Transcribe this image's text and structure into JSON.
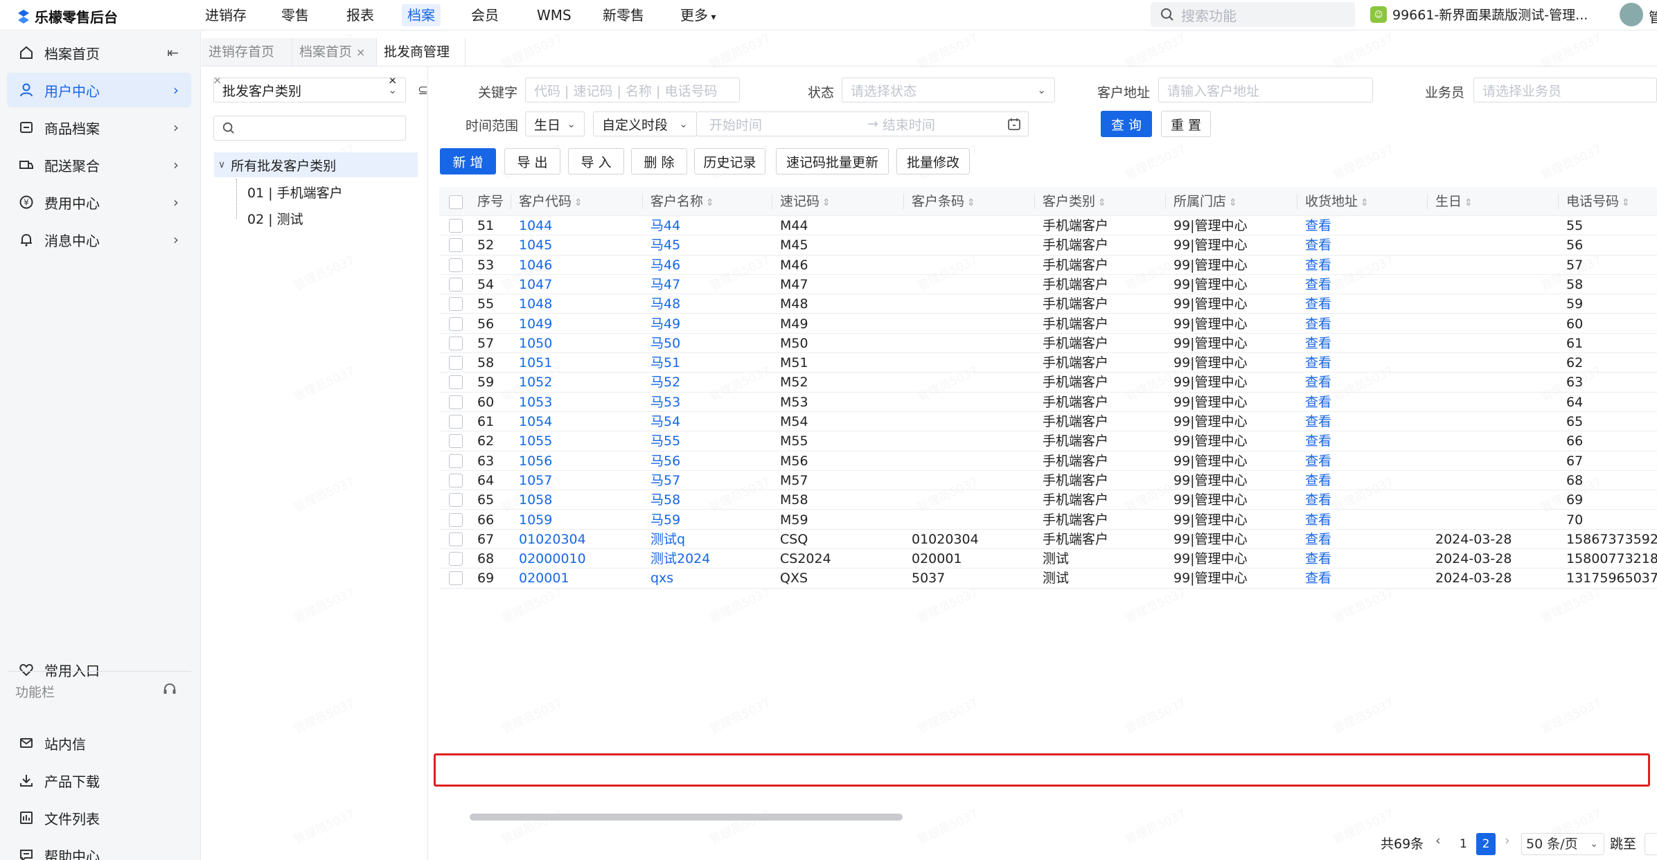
{
  "app": {
    "logo_text": "乐檬零售后台"
  },
  "topnav": [
    "进销存",
    "零售",
    "报表",
    "档案",
    "会员",
    "WMS",
    "新零售",
    "更多"
  ],
  "topnav_active_index": 3,
  "search": {
    "placeholder": "搜索功能"
  },
  "store": {
    "name": "99661-新界面果蔬版测试-管理...",
    "user_initial": "管"
  },
  "sidebar": {
    "items": [
      {
        "label": "档案首页",
        "icon": "home-icon"
      },
      {
        "label": "用户中心",
        "icon": "user-icon"
      },
      {
        "label": "商品档案",
        "icon": "box-icon"
      },
      {
        "label": "配送聚合",
        "icon": "delivery-icon"
      },
      {
        "label": "费用中心",
        "icon": "yen-icon"
      },
      {
        "label": "消息中心",
        "icon": "bell-icon"
      }
    ],
    "active_index": 1,
    "favorites": "常用入口",
    "funcbar_title": "功能栏",
    "bottom_items": [
      {
        "label": "站内信",
        "icon": "mail-icon"
      },
      {
        "label": "产品下载",
        "icon": "download-icon"
      },
      {
        "label": "文件列表",
        "icon": "file-list-icon"
      },
      {
        "label": "帮助中心",
        "icon": "help-icon"
      }
    ]
  },
  "tabs": [
    {
      "label": "进销存首页",
      "close": "×"
    },
    {
      "label": "档案首页",
      "close": "×"
    },
    {
      "label": "批发商管理",
      "close": "×"
    }
  ],
  "category": {
    "select": "批发客户类别",
    "tree_root": "所有批发客户类别",
    "tree_children": [
      "01 | 手机端客户",
      "02 | 测试"
    ]
  },
  "filters": {
    "keyword_label": "关键字",
    "keyword_placeholder": "代码 | 速记码 | 名称 | 电话号码",
    "status_label": "状态",
    "status_placeholder": "请选择状态",
    "address_label": "客户地址",
    "address_placeholder": "请输入客户地址",
    "salesman_label": "业务员",
    "salesman_placeholder": "请选择业务员",
    "time_label": "时间范围",
    "time_type": "生日",
    "time_mode": "自定义时段",
    "start_placeholder": "开始时间",
    "end_placeholder": "结束时间",
    "query_button": "查 询",
    "reset_button": "重 置"
  },
  "toolbar": [
    "新 增",
    "导 出",
    "导 入",
    "删 除",
    "历史记录",
    "速记码批量更新",
    "批量修改"
  ],
  "table": {
    "columns": [
      "序号",
      "客户代码",
      "客户名称",
      "速记码",
      "客户条码",
      "客户类别",
      "所属门店",
      "收货地址",
      "生日",
      "电话号码"
    ],
    "rows": [
      [
        "51",
        "1044",
        "马44",
        "M44",
        "",
        "手机端客户",
        "99|管理中心",
        "查看",
        "",
        "55"
      ],
      [
        "52",
        "1045",
        "马45",
        "M45",
        "",
        "手机端客户",
        "99|管理中心",
        "查看",
        "",
        "56"
      ],
      [
        "53",
        "1046",
        "马46",
        "M46",
        "",
        "手机端客户",
        "99|管理中心",
        "查看",
        "",
        "57"
      ],
      [
        "54",
        "1047",
        "马47",
        "M47",
        "",
        "手机端客户",
        "99|管理中心",
        "查看",
        "",
        "58"
      ],
      [
        "55",
        "1048",
        "马48",
        "M48",
        "",
        "手机端客户",
        "99|管理中心",
        "查看",
        "",
        "59"
      ],
      [
        "56",
        "1049",
        "马49",
        "M49",
        "",
        "手机端客户",
        "99|管理中心",
        "查看",
        "",
        "60"
      ],
      [
        "57",
        "1050",
        "马50",
        "M50",
        "",
        "手机端客户",
        "99|管理中心",
        "查看",
        "",
        "61"
      ],
      [
        "58",
        "1051",
        "马51",
        "M51",
        "",
        "手机端客户",
        "99|管理中心",
        "查看",
        "",
        "62"
      ],
      [
        "59",
        "1052",
        "马52",
        "M52",
        "",
        "手机端客户",
        "99|管理中心",
        "查看",
        "",
        "63"
      ],
      [
        "60",
        "1053",
        "马53",
        "M53",
        "",
        "手机端客户",
        "99|管理中心",
        "查看",
        "",
        "64"
      ],
      [
        "61",
        "1054",
        "马54",
        "M54",
        "",
        "手机端客户",
        "99|管理中心",
        "查看",
        "",
        "65"
      ],
      [
        "62",
        "1055",
        "马55",
        "M55",
        "",
        "手机端客户",
        "99|管理中心",
        "查看",
        "",
        "66"
      ],
      [
        "63",
        "1056",
        "马56",
        "M56",
        "",
        "手机端客户",
        "99|管理中心",
        "查看",
        "",
        "67"
      ],
      [
        "64",
        "1057",
        "马57",
        "M57",
        "",
        "手机端客户",
        "99|管理中心",
        "查看",
        "",
        "68"
      ],
      [
        "65",
        "1058",
        "马58",
        "M58",
        "",
        "手机端客户",
        "99|管理中心",
        "查看",
        "",
        "69"
      ],
      [
        "66",
        "1059",
        "马59",
        "M59",
        "",
        "手机端客户",
        "99|管理中心",
        "查看",
        "",
        "70"
      ],
      [
        "67",
        "01020304",
        "测试q",
        "CSQ",
        "01020304",
        "手机端客户",
        "99|管理中心",
        "查看",
        "2024-03-28",
        "15867373592"
      ],
      [
        "68",
        "02000010",
        "测试2024",
        "CS2024",
        "020001",
        "测试",
        "99|管理中心",
        "查看",
        "2024-03-28",
        "15800773218"
      ],
      [
        "69",
        "020001",
        "qxs",
        "QXS",
        "5037",
        "测试",
        "99|管理中心",
        "查看",
        "2024-03-28",
        "13175965037"
      ]
    ],
    "highlight_row": 18
  },
  "pagination": {
    "total": "共69条",
    "pages": [
      "1",
      "2"
    ],
    "current": "2",
    "page_size": "50 条/页",
    "jump_label": "跳至"
  },
  "watermark": "管理员5037",
  "colors": {
    "accent": "#1766e6",
    "highlight": "#e02020"
  }
}
